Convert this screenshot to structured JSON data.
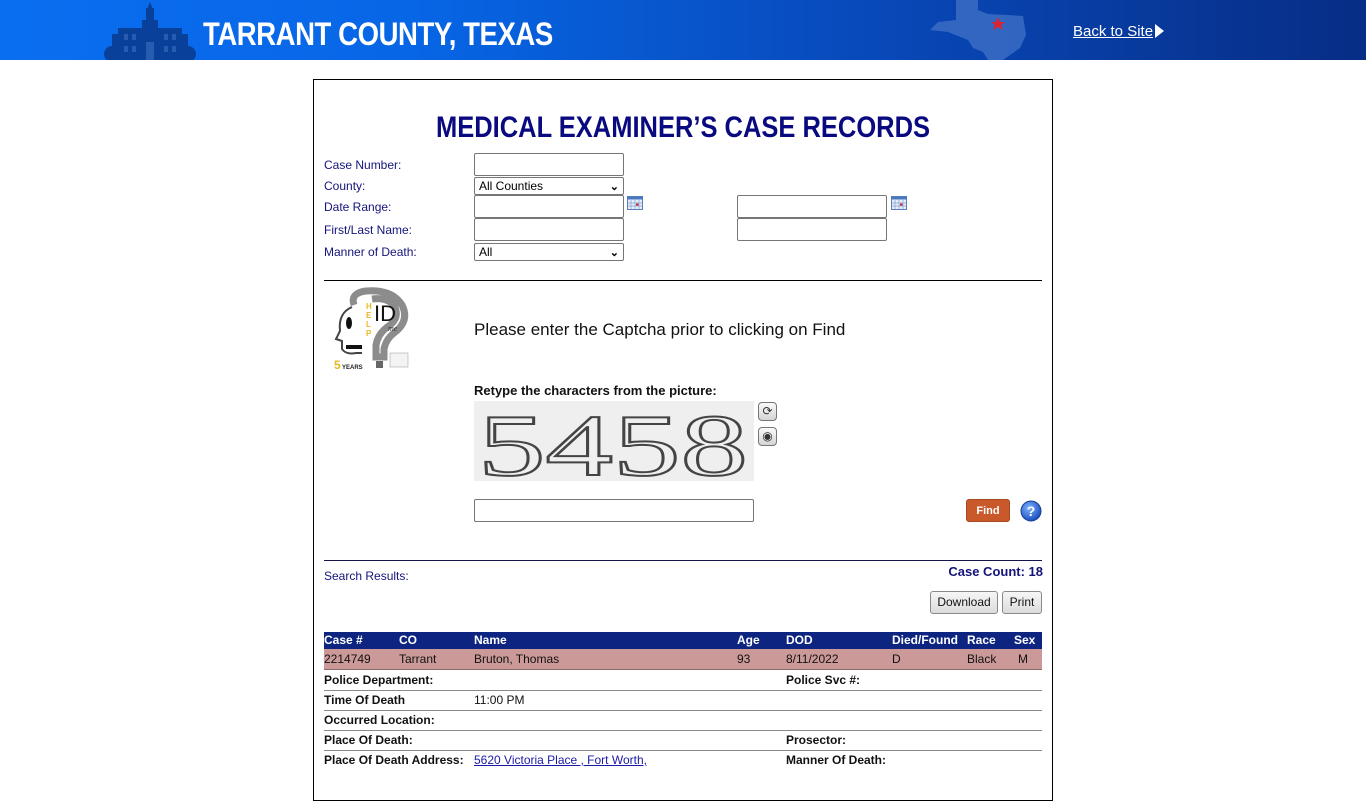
{
  "header": {
    "site_title": "TARRANT COUNTY, TEXAS",
    "back_link": "Back to Site"
  },
  "page_title": "MEDICAL EXAMINER’S CASE RECORDS",
  "form": {
    "case_number_label": "Case Number:",
    "case_number_value": "",
    "county_label": "County:",
    "county_selected": "All Counties",
    "date_range_label": "Date Range:",
    "date_from_value": "",
    "date_to_value": "",
    "name_label": "First/Last Name:",
    "first_name_value": "",
    "last_name_value": "",
    "manner_label": "Manner of Death:",
    "manner_selected": "All"
  },
  "captcha": {
    "message": "Please enter the Captcha prior to clicking on Find",
    "label": "Retype the characters from the picture:",
    "image_text": "5458",
    "input_value": "",
    "find_label": "Find"
  },
  "logo": {
    "text_id": "ID",
    "text_help": "HELP",
    "text_me": "me",
    "years": "5",
    "years_label": "YEARS"
  },
  "results": {
    "label": "Search Results:",
    "case_count": "Case Count: 18",
    "download_label": "Download",
    "print_label": "Print",
    "columns": [
      "Case #",
      "CO",
      "Name",
      "Age",
      "DOD",
      "Died/Found",
      "Race",
      "Sex"
    ],
    "rows": [
      [
        "2214749",
        "Tarrant",
        "Bruton, Thomas",
        "93",
        "8/11/2022",
        "D",
        "Black",
        "M"
      ]
    ],
    "details": {
      "police_department_label": "Police Department:",
      "police_department_value": "",
      "police_svc_label": "Police Svc #:",
      "police_svc_value": "",
      "time_of_death_label": "Time Of Death",
      "time_of_death_value": "11:00 PM",
      "occurred_location_label": "Occurred Location:",
      "occurred_location_value": "",
      "place_of_death_label": "Place Of Death:",
      "place_of_death_value": "",
      "prosector_label": "Prosector:",
      "prosector_value": "",
      "address_label": "Place Of Death Address:",
      "address_value": "5620 Victoria Place , Fort Worth,",
      "manner_label": "Manner Of Death:",
      "manner_value": ""
    }
  },
  "colors": {
    "header_blue": "#0a6ef0",
    "header_dark": "#072d85",
    "navy_text": "#14147a",
    "table_header": "#0d2580",
    "row_highlight": "#cc9999",
    "find_button": "#c9582b"
  }
}
